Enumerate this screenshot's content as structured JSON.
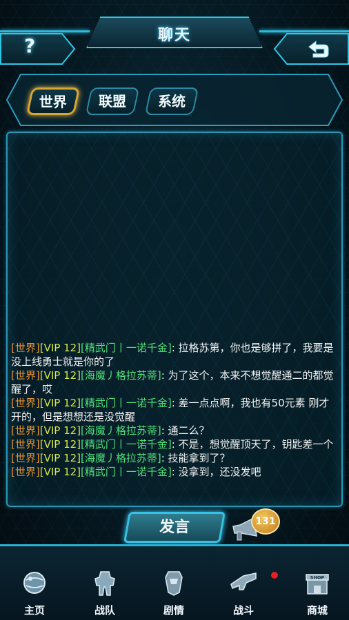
{
  "header": {
    "title": "聊天",
    "help_glyph": "?",
    "back_icon": "return-arrow-icon"
  },
  "tabs": [
    {
      "label": "世界",
      "active": true
    },
    {
      "label": "联盟",
      "active": false
    },
    {
      "label": "系统",
      "active": false
    }
  ],
  "messages": [
    {
      "channel": "[世界]",
      "vip": "[VIP 12]",
      "name": "[精武门丨一诺千金]",
      "text": ": 拉格苏第，你也是够拼了，我要是没上线勇士就是你的了"
    },
    {
      "channel": "[世界]",
      "vip": "[VIP 12]",
      "name": "[海魔丿格拉苏蒂]",
      "text": ": 为了这个，本来不想觉醒通二的都觉醒了，哎"
    },
    {
      "channel": "[世界]",
      "vip": "[VIP 12]",
      "name": "[精武门丨一诺千金]",
      "text": ": 差一点点啊，我也有50元素 刚才开的，但是想想还是没觉醒"
    },
    {
      "channel": "[世界]",
      "vip": "[VIP 12]",
      "name": "[海魔丿格拉苏蒂]",
      "text": ": 通二么？"
    },
    {
      "channel": "[世界]",
      "vip": "[VIP 12]",
      "name": "[精武门丨一诺千金]",
      "text": ": 不是，想觉醒顶天了，钥匙差一个"
    },
    {
      "channel": "[世界]",
      "vip": "[VIP 12]",
      "name": "[海魔丿格拉苏蒂]",
      "text": ": 技能拿到了？"
    },
    {
      "channel": "[世界]",
      "vip": "[VIP 12]",
      "name": "[精武门丨一诺千金]",
      "text": ": 没拿到，还没发吧"
    }
  ],
  "speak_button": "发言",
  "horn_count": "131",
  "bottom_nav": [
    {
      "label": "主页",
      "icon": "planet-home-icon"
    },
    {
      "label": "战队",
      "icon": "robot-team-icon"
    },
    {
      "label": "剧情",
      "icon": "autobot-emblem-icon"
    },
    {
      "label": "战斗",
      "icon": "blaster-gun-icon"
    },
    {
      "label": "商城",
      "icon": "shop-icon"
    }
  ],
  "colors": {
    "channel": "#e8922e",
    "vip": "#d6e94a",
    "name": "#4fe07a",
    "accent": "#2ec6e6",
    "active_tab": "#d9a634"
  }
}
